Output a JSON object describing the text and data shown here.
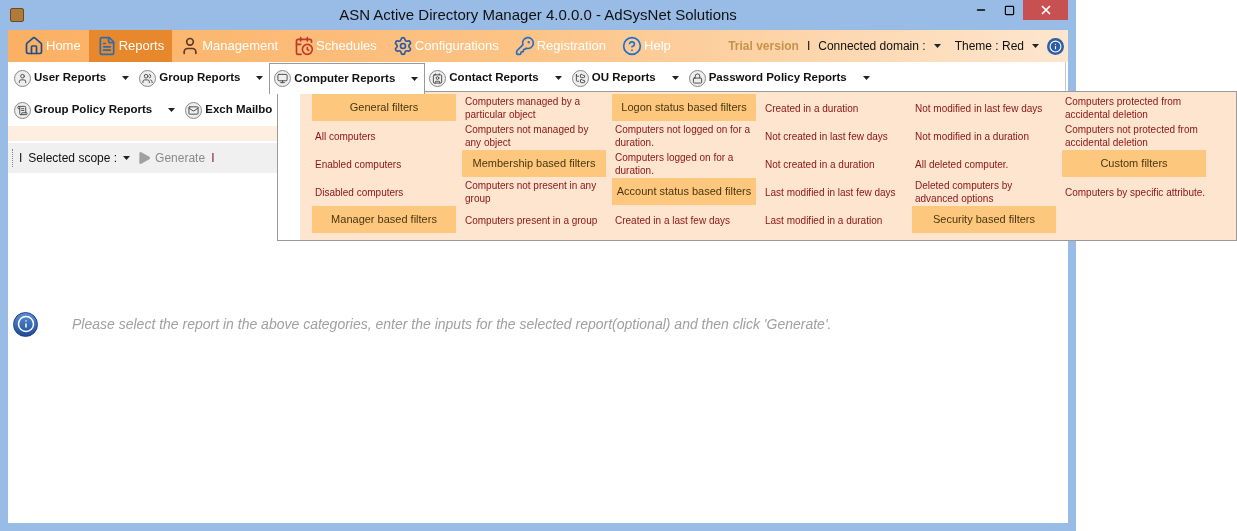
{
  "window": {
    "title": "ASN Active Directory Manager 4.0.0.0 - AdSysNet Solutions"
  },
  "nav_tabs": [
    {
      "label": "Home",
      "selected": false
    },
    {
      "label": "Reports",
      "selected": true
    },
    {
      "label": "Management",
      "selected": false
    },
    {
      "label": "Schedules",
      "selected": false
    },
    {
      "label": "Configurations",
      "selected": false
    },
    {
      "label": "Registration",
      "selected": false
    },
    {
      "label": "Help",
      "selected": false
    }
  ],
  "header_right": {
    "trial": "Trial version",
    "separator": "I",
    "domain_label": "Connected domain :",
    "theme_label": "Theme : Red"
  },
  "report_toolbar": [
    [
      {
        "label": "User Reports",
        "open": false
      },
      {
        "label": "Group Reports",
        "open": false
      },
      {
        "label": "Computer Reports",
        "open": true
      },
      {
        "label": "Contact Reports",
        "open": false
      },
      {
        "label": "OU Reports",
        "open": false
      },
      {
        "label": "Password Policy Reports",
        "open": false
      }
    ],
    [
      {
        "label": "Group Policy Reports",
        "open": false
      },
      {
        "label": "Exch Mailbo",
        "open": false,
        "cut": true
      }
    ]
  ],
  "scope_bar": {
    "separator_left": "I",
    "scope_label": "Selected scope :",
    "generate": "Generate",
    "generate_disabled": true,
    "separator_right": "I"
  },
  "dropdown": {
    "columns": [
      [
        {
          "kind": "header",
          "label": "General filters"
        },
        {
          "kind": "item",
          "label": "All computers"
        },
        {
          "kind": "item",
          "label": "Enabled computers"
        },
        {
          "kind": "item",
          "label": "Disabled computers"
        },
        {
          "kind": "header",
          "label": "Manager based filters"
        }
      ],
      [
        {
          "kind": "item",
          "label": "Computers managed by a particular object"
        },
        {
          "kind": "item",
          "label": "Computers not managed by any object"
        },
        {
          "kind": "header",
          "label": "Membership based filters"
        },
        {
          "kind": "item",
          "label": "Computers not present in any group"
        },
        {
          "kind": "item",
          "label": "Computers present in a group"
        }
      ],
      [
        {
          "kind": "header",
          "label": "Logon status based filters"
        },
        {
          "kind": "item",
          "label": "Computers not logged on for a duration."
        },
        {
          "kind": "item",
          "label": "Computers logged on for a duration."
        },
        {
          "kind": "header",
          "label": "Account status based filters"
        },
        {
          "kind": "item",
          "label": "Created in a last few days"
        }
      ],
      [
        {
          "kind": "item",
          "label": "Created in a duration"
        },
        {
          "kind": "item",
          "label": "Not created in last few days"
        },
        {
          "kind": "item",
          "label": "Not created in a duration"
        },
        {
          "kind": "item",
          "label": "Last modified in last few days"
        },
        {
          "kind": "item",
          "label": "Last modified in a duration"
        }
      ],
      [
        {
          "kind": "item",
          "label": "Not modified in last few days"
        },
        {
          "kind": "item",
          "label": "Not modified in a duration"
        },
        {
          "kind": "item",
          "label": "All deleted computer."
        },
        {
          "kind": "item",
          "label": "Deleted computers by advanced options"
        },
        {
          "kind": "header",
          "label": "Security based filters"
        }
      ],
      [
        {
          "kind": "item",
          "label": "Computers protected from accidental deletion"
        },
        {
          "kind": "item",
          "label": "Computers not protected from accidental deletion"
        },
        {
          "kind": "header",
          "label": "Custom filters"
        },
        {
          "kind": "item",
          "label": "Computers by specific attribute."
        }
      ]
    ]
  },
  "message": "Please select the report in the above categories, enter the inputs for the selected report(optional) and then click 'Generate'."
}
